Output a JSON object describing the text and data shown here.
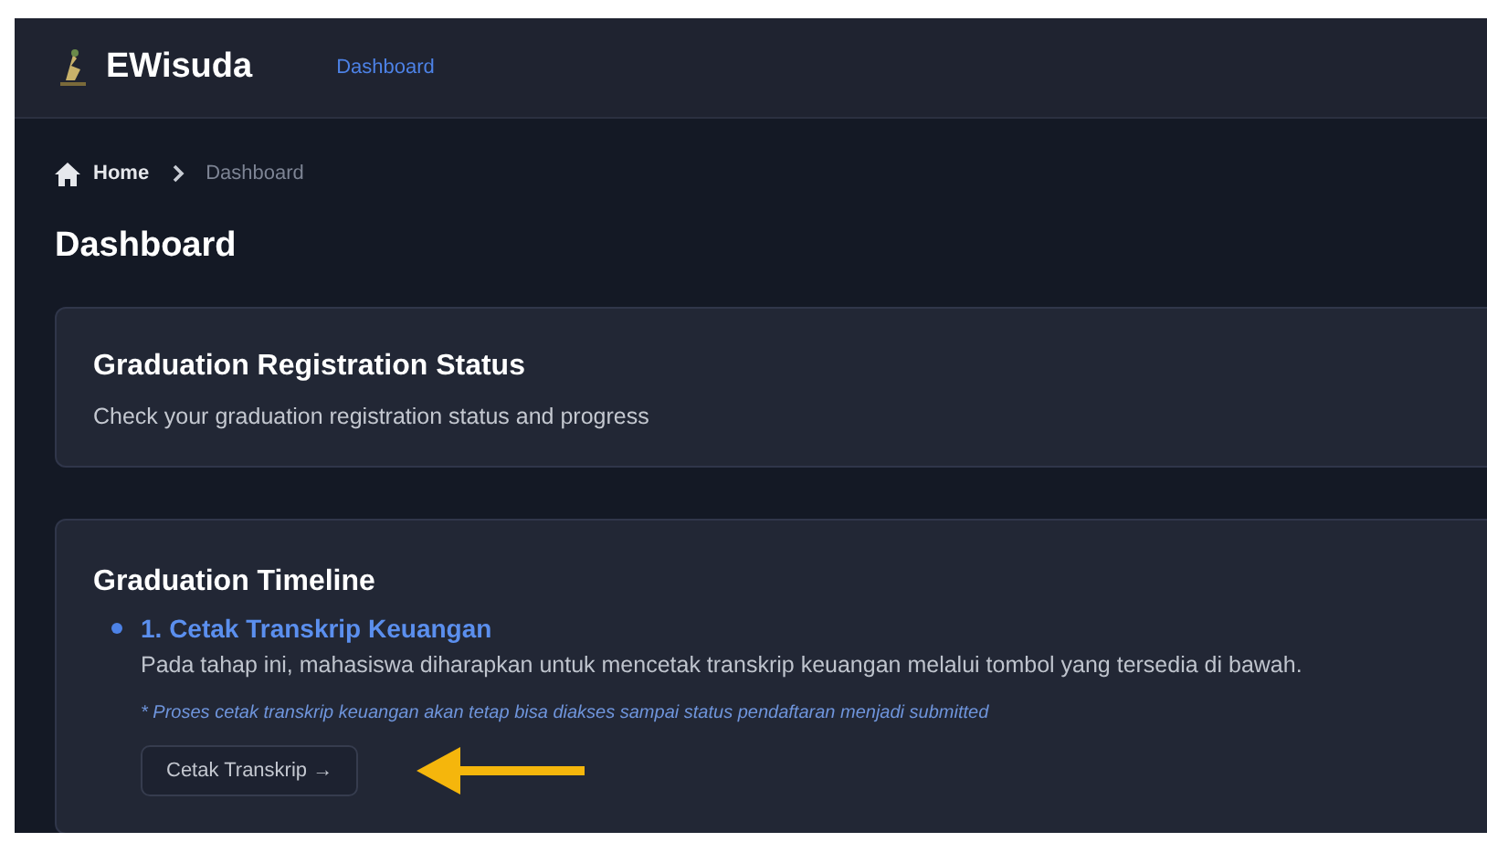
{
  "header": {
    "brand": "EWisuda",
    "nav": [
      {
        "label": "Dashboard",
        "selected": true
      }
    ]
  },
  "breadcrumb": [
    {
      "label": "Home",
      "kind": "home"
    },
    {
      "label": "Dashboard",
      "kind": "current"
    }
  ],
  "page_title": "Dashboard",
  "status_card": {
    "title": "Graduation Registration Status",
    "subtitle": "Check your graduation registration status and progress"
  },
  "timeline": {
    "title": "Graduation Timeline",
    "steps": [
      {
        "title": "1. Cetak Transkrip Keuangan",
        "description": "Pada tahap ini, mahasiswa diharapkan untuk mencetak transkrip keuangan melalui tombol yang tersedia di bawah.",
        "note": "* Proses cetak transkrip keuangan akan tetap bisa diakses sampai status pendaftaran menjadi submitted",
        "button": "Cetak Transkrip →",
        "pointer": true
      }
    ]
  }
}
